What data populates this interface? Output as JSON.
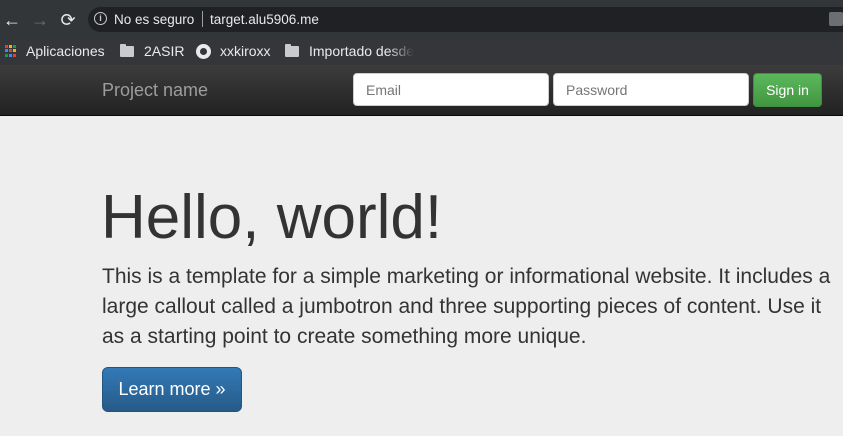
{
  "browser": {
    "back_label": "←",
    "forward_label": "→",
    "reload_label": "⟳",
    "security_text": "No es seguro",
    "url": "target.alu5906.me",
    "bookmarks": [
      {
        "label": "Aplicaciones",
        "icon": "apps-icon"
      },
      {
        "label": "2ASIR",
        "icon": "folder-icon"
      },
      {
        "label": "xxkiroxx",
        "icon": "github-icon"
      },
      {
        "label": "Importado desde",
        "icon": "folder-icon"
      }
    ]
  },
  "navbar": {
    "brand": "Project name",
    "email_placeholder": "Email",
    "password_placeholder": "Password",
    "signin_label": "Sign in"
  },
  "jumbotron": {
    "title": "Hello, world!",
    "text": "This is a template for a simple marketing or informational website. It includes a large callout called a jumbotron and three supporting pieces of content. Use it as a starting point to create something more unique.",
    "button_label": "Learn more »"
  },
  "colors": {
    "navbar_bg": "#222222",
    "signin_green": "#5cb85c",
    "learn_blue": "#337ab7",
    "page_bg": "#eeeeee"
  }
}
